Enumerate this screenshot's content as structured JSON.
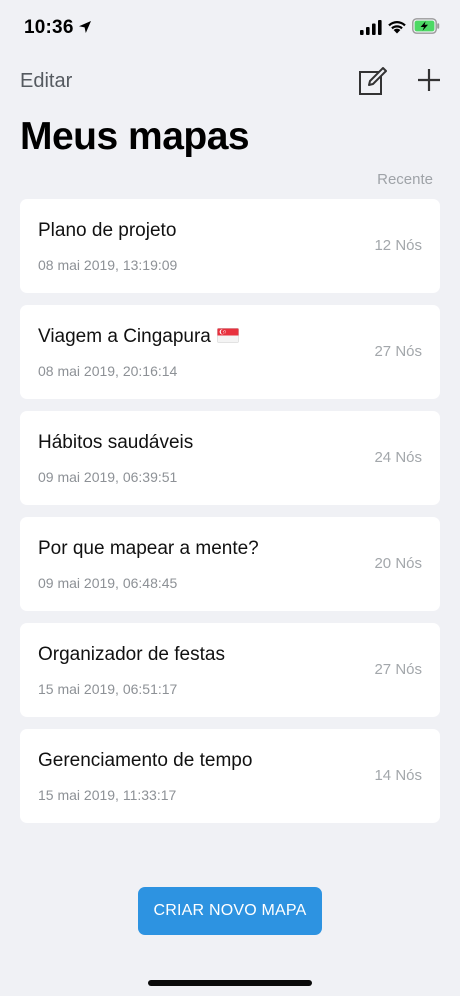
{
  "status_bar": {
    "time": "10:36",
    "icons": [
      "location-arrow-icon",
      "signal-icon",
      "wifi-icon",
      "battery-charging-icon"
    ]
  },
  "nav": {
    "edit_label": "Editar",
    "compose_icon": "compose-icon",
    "add_icon": "plus-icon"
  },
  "title": "Meus mapas",
  "sort_label": "Recente",
  "maps": [
    {
      "title": "Plano de projeto",
      "date": "08 mai 2019, 13:19:09",
      "nodes": "12 Nós"
    },
    {
      "title": "Viagem a Cingapura",
      "date": "08 mai 2019, 20:16:14",
      "nodes": "27 Nós",
      "emoji": "singapore-flag-icon"
    },
    {
      "title": "Hábitos saudáveis",
      "date": "09 mai 2019, 06:39:51",
      "nodes": "24 Nós"
    },
    {
      "title": "Por que mapear a mente?",
      "date": "09 mai 2019, 06:48:45",
      "nodes": "20 Nós"
    },
    {
      "title": "Organizador de festas",
      "date": "15 mai 2019, 06:51:17",
      "nodes": "27 Nós"
    },
    {
      "title": "Gerenciamento de tempo",
      "date": "15 mai 2019, 11:33:17",
      "nodes": "14 Nós"
    }
  ],
  "create_button_label": "CRIAR NOVO MAPA",
  "colors": {
    "background": "#f0f1f5",
    "card": "#ffffff",
    "accent": "#2d93e1",
    "battery_green": "#4cd964"
  }
}
